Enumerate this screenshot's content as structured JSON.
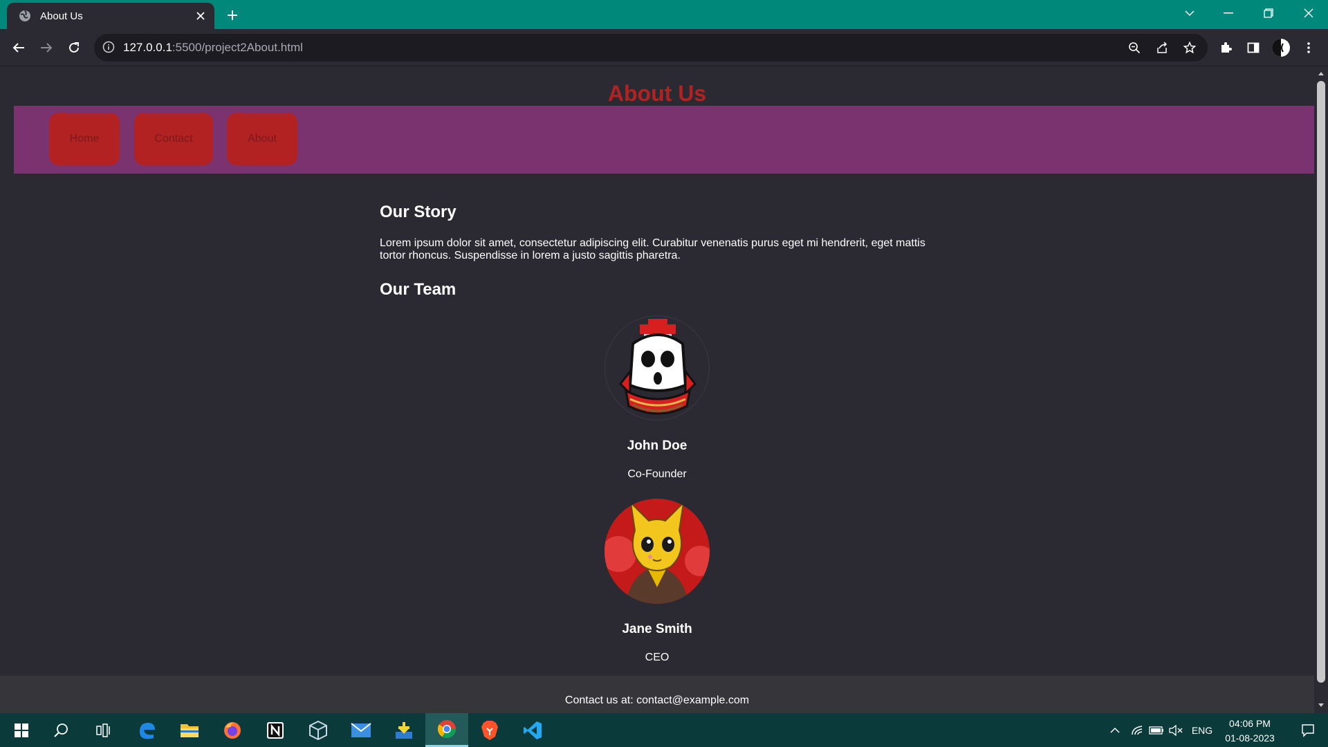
{
  "browser": {
    "tab_title": "About Us",
    "url_host": "127.0.0.1",
    "url_path": ":5500/project2About.html",
    "accent": "#00897b"
  },
  "page": {
    "title": "About Us",
    "title_color": "#b22222",
    "nav_color": "#7b3370",
    "nav": [
      {
        "label": "Home"
      },
      {
        "label": "Contact"
      },
      {
        "label": "About"
      }
    ],
    "story_heading": "Our Story",
    "story_text": "Lorem ipsum dolor sit amet, consectetur adipiscing elit. Curabitur venenatis purus eget mi hendrerit, eget mattis tortor rhoncus. Suspendisse in lorem a justo sagittis pharetra.",
    "team_heading": "Our Team",
    "team": [
      {
        "name": "John Doe",
        "role": "Co-Founder",
        "avatar": "shy-guy-avatar"
      },
      {
        "name": "Jane Smith",
        "role": "CEO",
        "avatar": "yellow-cat-avatar"
      }
    ],
    "footer": "Contact us at: contact@example.com"
  },
  "taskbar": {
    "icons": [
      "windows-start-icon",
      "search-icon",
      "task-view-icon",
      "edge-icon",
      "file-explorer-icon",
      "firefox-icon",
      "notion-icon",
      "virtualbox-icon",
      "mail-icon",
      "download-app-icon",
      "chrome-icon",
      "brave-icon",
      "vscode-icon"
    ],
    "language": "ENG",
    "time": "04:06 PM",
    "date": "01-08-2023"
  }
}
